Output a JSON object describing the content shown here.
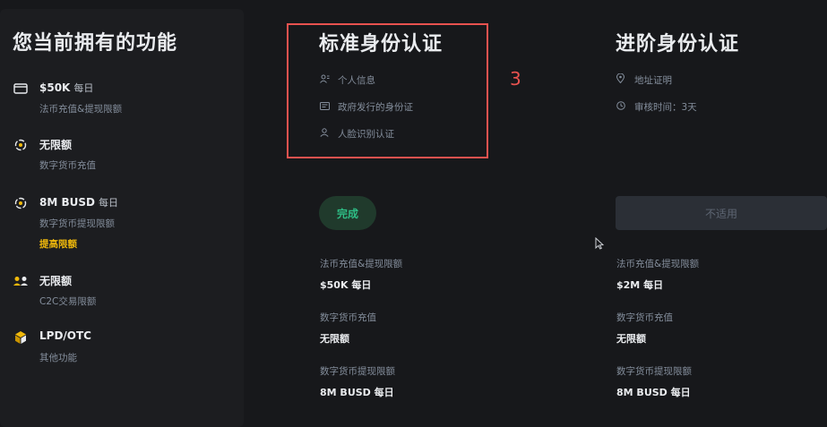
{
  "left_panel": {
    "title": "您当前拥有的功能",
    "features": [
      {
        "icon": "card-icon",
        "name": "$50K",
        "suffix": "每日",
        "desc": "法币充值&提现限额",
        "link": ""
      },
      {
        "icon": "crypto-deposit-icon",
        "name": "无限额",
        "suffix": "",
        "desc": "数字货币充值",
        "link": ""
      },
      {
        "icon": "crypto-withdraw-icon",
        "name": "8M BUSD",
        "suffix": "每日",
        "desc": "数字货币提现限额",
        "link": "提高限额"
      },
      {
        "icon": "users-icon",
        "name": "无限额",
        "suffix": "",
        "desc": "C2C交易限额",
        "link": ""
      },
      {
        "icon": "cube-icon",
        "name": "LPD/OTC",
        "suffix": "",
        "desc": "其他功能",
        "link": ""
      }
    ]
  },
  "standard": {
    "title": "标准身份认证",
    "requirements": [
      {
        "icon": "person-info-icon",
        "text": "个人信息"
      },
      {
        "icon": "id-card-icon",
        "text": "政府发行的身份证"
      },
      {
        "icon": "face-icon",
        "text": "人脸识别认证"
      }
    ],
    "status_label": "完成",
    "limits": [
      {
        "label": "法币充值&提现限额",
        "value": "$50K 每日"
      },
      {
        "label": "数字货币充值",
        "value": "无限额"
      },
      {
        "label": "数字货币提现限额",
        "value": "8M BUSD 每日"
      }
    ]
  },
  "annotation": "3",
  "advanced": {
    "title": "进阶身份认证",
    "requirements": [
      {
        "icon": "location-icon",
        "text": "地址证明"
      },
      {
        "icon": "clock-icon",
        "text": "审核时间：3天"
      }
    ],
    "status_label": "不适用",
    "limits": [
      {
        "label": "法币充值&提现限额",
        "value": "$2M 每日"
      },
      {
        "label": "数字货币充值",
        "value": "无限额"
      },
      {
        "label": "数字货币提现限额",
        "value": "8M BUSD 每日"
      }
    ]
  },
  "colors": {
    "background": "#17181b",
    "panel": "#1c1d20",
    "accent_yellow": "#f0b90b",
    "success_green": "#2ebd85",
    "annotation_red": "#e8524f"
  }
}
